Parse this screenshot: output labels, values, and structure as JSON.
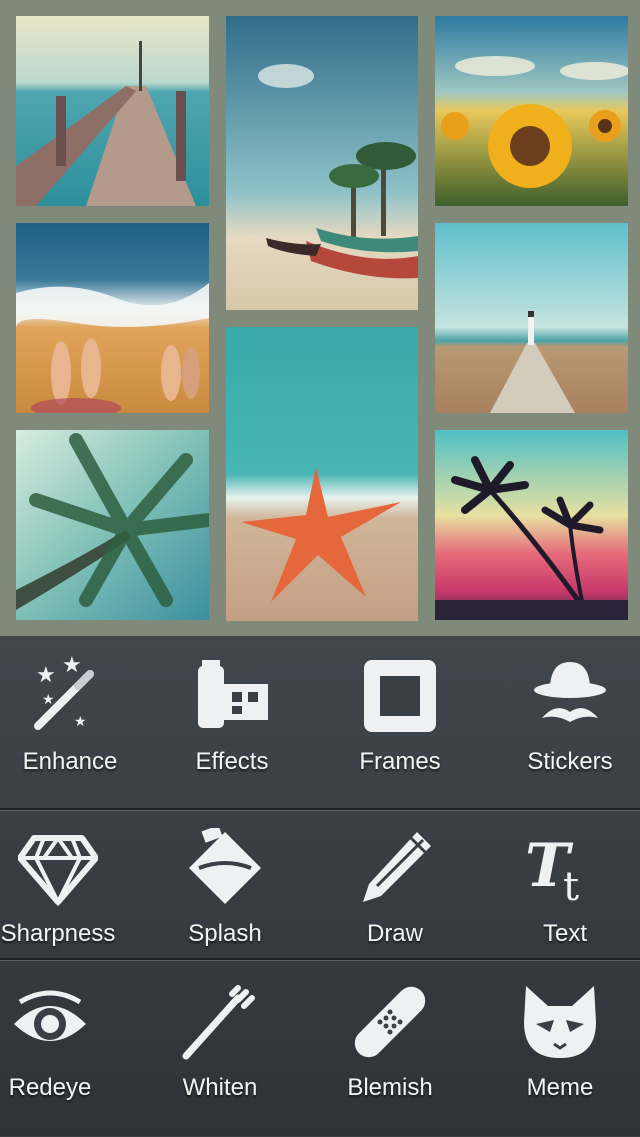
{
  "collage": {
    "photos": [
      {
        "name": "pier",
        "description_color": "#6fa7b2"
      },
      {
        "name": "boats-beach",
        "description_color": "#4f7fa0"
      },
      {
        "name": "sunflowers",
        "description_color": "#d9a623"
      },
      {
        "name": "feet-waves",
        "description_color": "#2c6b8f"
      },
      {
        "name": "starfish",
        "description_color": "#3fb3b0"
      },
      {
        "name": "lighthouse-road",
        "description_color": "#7fc6d1"
      },
      {
        "name": "palm-tree",
        "description_color": "#5ea69b"
      },
      {
        "name": "sunset-palms",
        "description_color": "#c84d6a"
      }
    ]
  },
  "tools": {
    "row1": [
      {
        "label": "Enhance",
        "icon": "magic-wand-icon"
      },
      {
        "label": "Effects",
        "icon": "film-icon"
      },
      {
        "label": "Frames",
        "icon": "frame-icon"
      },
      {
        "label": "Stickers",
        "icon": "hat-mustache-icon"
      }
    ],
    "row2": [
      {
        "label": "Sharpness",
        "icon": "diamond-icon"
      },
      {
        "label": "Splash",
        "icon": "paint-bucket-icon"
      },
      {
        "label": "Draw",
        "icon": "pencil-icon"
      },
      {
        "label": "Text",
        "icon": "text-tt-icon"
      }
    ],
    "row3": [
      {
        "label": "Redeye",
        "icon": "eye-icon"
      },
      {
        "label": "Whiten",
        "icon": "toothbrush-icon"
      },
      {
        "label": "Blemish",
        "icon": "bandage-icon"
      },
      {
        "label": "Meme",
        "icon": "cat-mask-icon"
      }
    ]
  }
}
